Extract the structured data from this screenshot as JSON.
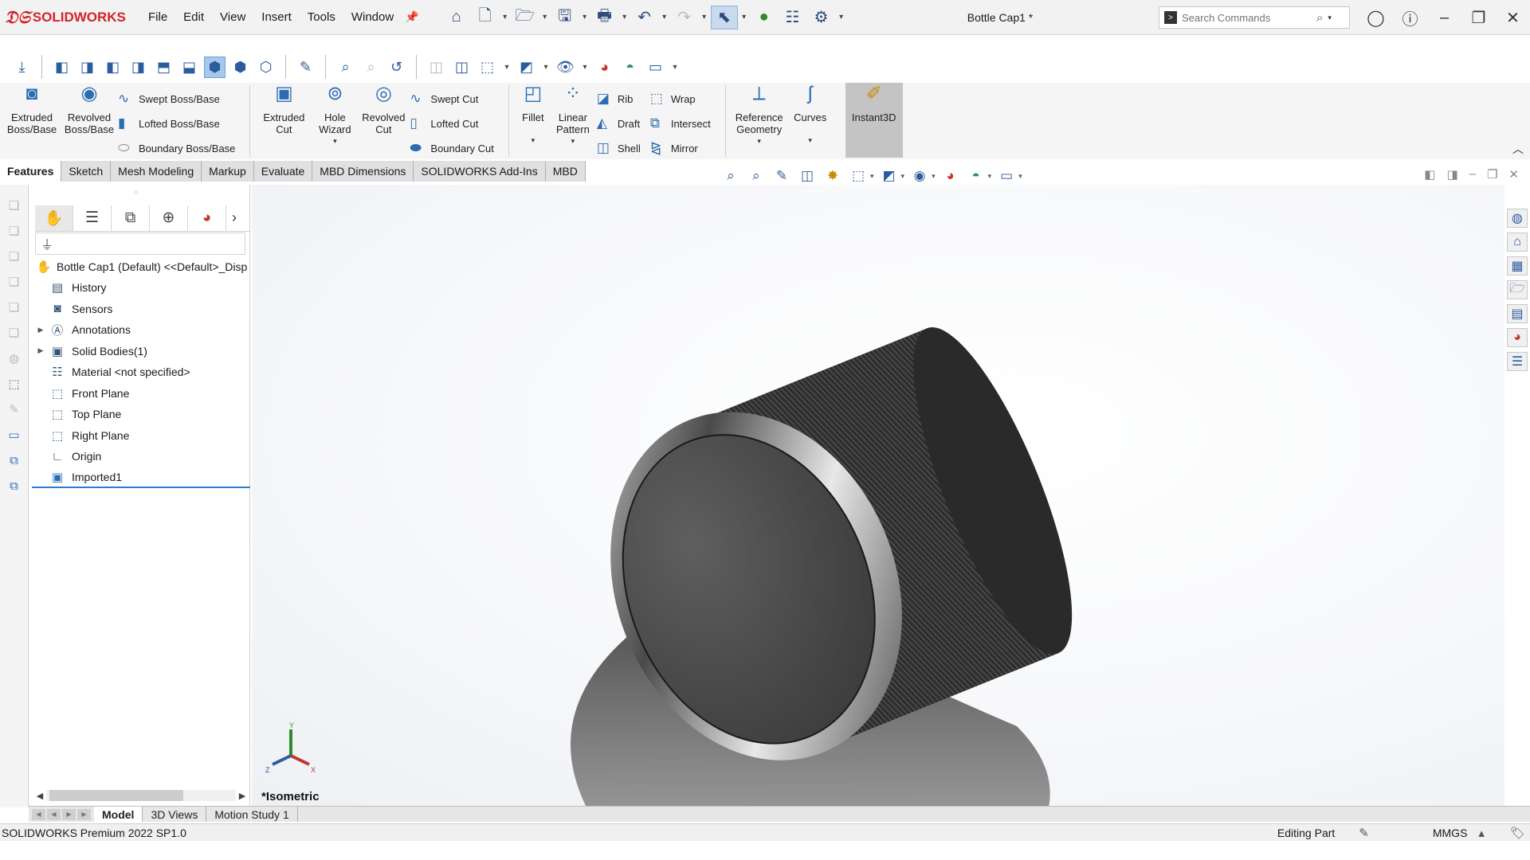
{
  "app": {
    "logo_brand": "SOLIDWORKS",
    "document_title": "Bottle Cap1 *"
  },
  "menu": [
    "File",
    "Edit",
    "View",
    "Insert",
    "Tools",
    "Window"
  ],
  "search": {
    "placeholder": "Search Commands"
  },
  "ribbon": {
    "extruded_boss": "Extruded Boss/Base",
    "revolved_boss": "Revolved Boss/Base",
    "swept_boss": "Swept Boss/Base",
    "lofted_boss": "Lofted Boss/Base",
    "boundary_boss": "Boundary Boss/Base",
    "extruded_cut": "Extruded Cut",
    "hole_wizard": "Hole Wizard",
    "revolved_cut": "Revolved Cut",
    "swept_cut": "Swept Cut",
    "lofted_cut": "Lofted Cut",
    "boundary_cut": "Boundary Cut",
    "fillet": "Fillet",
    "linear_pattern": "Linear Pattern",
    "rib": "Rib",
    "draft": "Draft",
    "shell": "Shell",
    "wrap": "Wrap",
    "intersect": "Intersect",
    "mirror": "Mirror",
    "reference_geometry": "Reference Geometry",
    "curves": "Curves",
    "instant3d": "Instant3D"
  },
  "command_tabs": [
    "Features",
    "Sketch",
    "Mesh Modeling",
    "Markup",
    "Evaluate",
    "MBD Dimensions",
    "SOLIDWORKS Add-Ins",
    "MBD"
  ],
  "tree": {
    "root": "Bottle Cap1 (Default) <<Default>_Disp",
    "items": [
      {
        "label": "History"
      },
      {
        "label": "Sensors"
      },
      {
        "label": "Annotations"
      },
      {
        "label": "Solid Bodies(1)"
      },
      {
        "label": "Material <not specified>"
      },
      {
        "label": "Front Plane"
      },
      {
        "label": "Top Plane"
      },
      {
        "label": "Right Plane"
      },
      {
        "label": "Origin"
      },
      {
        "label": "Imported1"
      }
    ]
  },
  "viewport": {
    "view_label": "*Isometric",
    "triad_x": "X",
    "triad_y": "Y",
    "triad_z": "Z"
  },
  "model_tabs": [
    "Model",
    "3D Views",
    "Motion Study 1"
  ],
  "status": {
    "product": "SOLIDWORKS Premium 2022 SP1.0",
    "mode": "Editing Part",
    "units": "MMGS"
  },
  "colors": {
    "brand": "#d2232a",
    "accent": "#2b6cb3",
    "selection": "#2f7dc6"
  }
}
